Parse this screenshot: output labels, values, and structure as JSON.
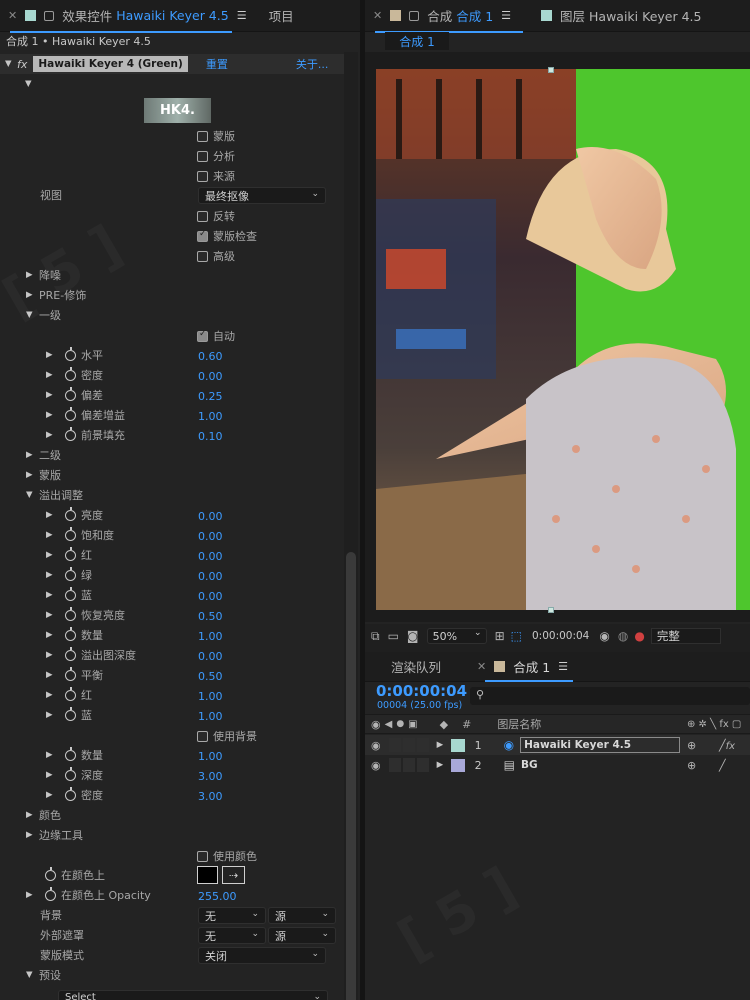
{
  "effects_panel": {
    "tab_label": "效果控件",
    "tab_effect": "Hawaiki Keyer 4.5",
    "project_tab": "项目",
    "breadcrumb": "合成 1 • Hawaiki Keyer 4.5",
    "effect_name": "Hawaiki Keyer 4 (Green)",
    "reset": "重置",
    "about": "关于...",
    "logo": "HK4.",
    "mask_cb": "蒙版",
    "analyze_cb": "分析",
    "source_cb": "来源",
    "view_label": "视图",
    "view_value": "最终抠像",
    "invert_cb": "反转",
    "mask_check_cb": "蒙版检查",
    "advanced_cb": "高级",
    "noise": "降噪",
    "pre_retouch": "PRE-修饰",
    "level1": "一级",
    "auto_cb": "自动",
    "level1_params": [
      {
        "label": "水平",
        "value": "0.60"
      },
      {
        "label": "密度",
        "value": "0.00"
      },
      {
        "label": "偏差",
        "value": "0.25"
      },
      {
        "label": "偏差增益",
        "value": "1.00"
      },
      {
        "label": "前景填充",
        "value": "0.10"
      }
    ],
    "level2": "二级",
    "mask_group": "蒙版",
    "spill": "溢出调整",
    "spill_params": [
      {
        "label": "亮度",
        "value": "0.00"
      },
      {
        "label": "饱和度",
        "value": "0.00"
      },
      {
        "label": "红",
        "value": "0.00"
      },
      {
        "label": "绿",
        "value": "0.00"
      },
      {
        "label": "蓝",
        "value": "0.00"
      },
      {
        "label": "恢复亮度",
        "value": "0.50"
      },
      {
        "label": "数量",
        "value": "1.00"
      },
      {
        "label": "溢出图深度",
        "value": "0.00"
      },
      {
        "label": "平衡",
        "value": "0.50"
      },
      {
        "label": "红",
        "value": "1.00"
      },
      {
        "label": "蓝",
        "value": "1.00"
      }
    ],
    "use_bg_cb": "使用背景",
    "bg_params": [
      {
        "label": "数量",
        "value": "1.00"
      },
      {
        "label": "深度",
        "value": "3.00"
      },
      {
        "label": "密度",
        "value": "3.00"
      }
    ],
    "color": "颜色",
    "edge_tools": "边缘工具",
    "use_color_cb": "使用颜色",
    "on_color": "在颜色上",
    "on_color_opacity": "在颜色上 Opacity",
    "on_color_opacity_value": "255.00",
    "background": "背景",
    "bg_sel1": "无",
    "bg_sel2": "源",
    "ext_matte": "外部遮罩",
    "ext_sel1": "无",
    "ext_sel2": "源",
    "mask_mode": "蒙版模式",
    "mask_mode_value": "关闭",
    "presets": "预设",
    "presets_value": "Select"
  },
  "comp_panel": {
    "tab_comp": "合成",
    "tab_comp_name": "合成 1",
    "tab_layer": "图层 Hawaiki Keyer 4.5",
    "comp_chip": "合成 1",
    "zoom": "50%",
    "timecode": "0:00:00:04",
    "quality": "完整"
  },
  "timeline": {
    "render_queue": "渲染队列",
    "comp_tab": "合成 1",
    "timecode": "0:00:00:04",
    "frame_info": "00004 (25.00 fps)",
    "col_num": "#",
    "col_name": "图层名称",
    "layers": [
      {
        "num": "1",
        "name": "Hawaiki Keyer 4.5",
        "color": "#a8d8d0"
      },
      {
        "num": "2",
        "name": "BG",
        "color": "#a8a8d8"
      }
    ]
  },
  "colors": {
    "accent": "#3d9bff",
    "greenscreen": "#4ec62d"
  }
}
